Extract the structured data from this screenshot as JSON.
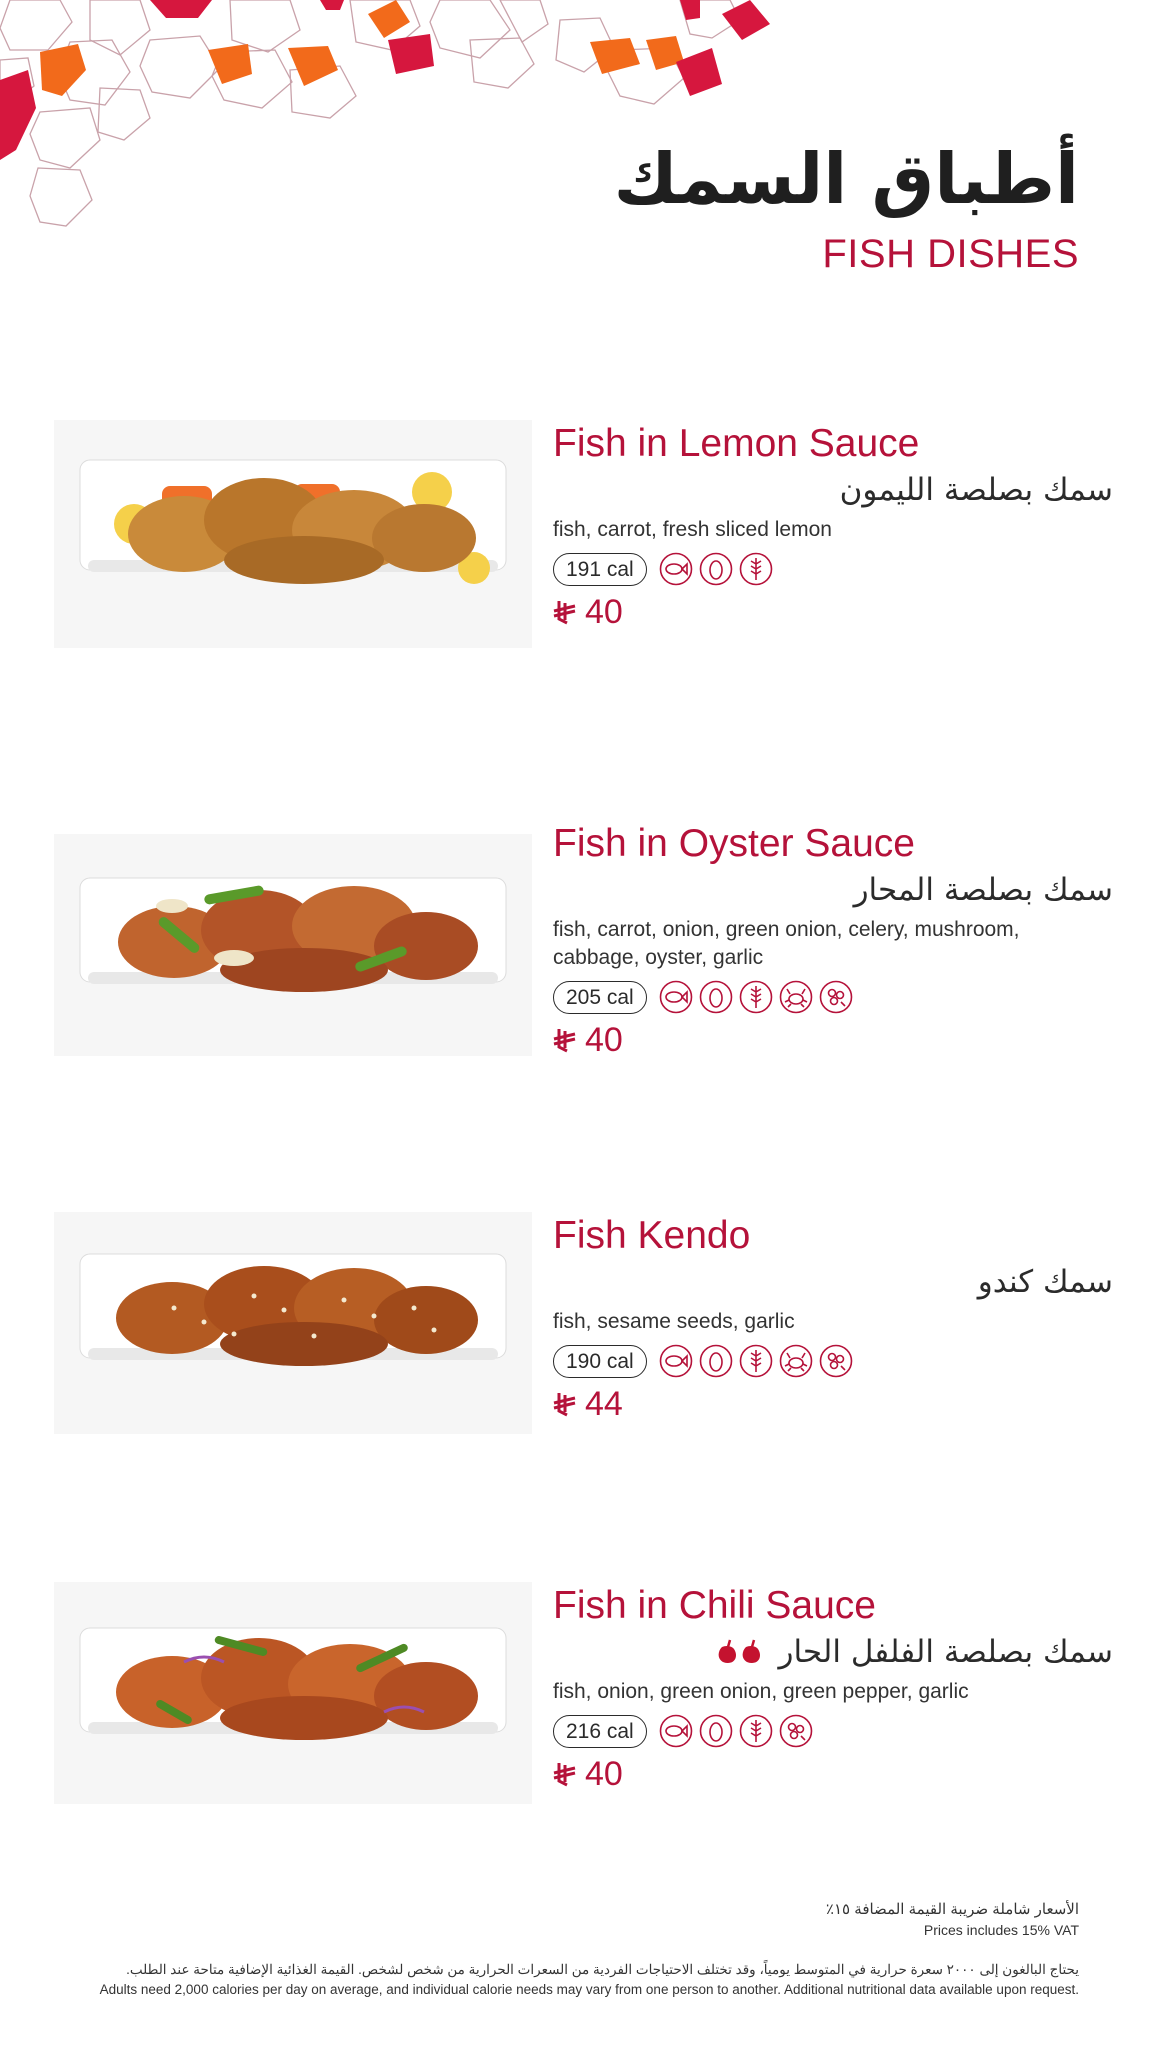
{
  "header": {
    "title_ar": "أطباق السمك",
    "title_en": "FISH DISHES"
  },
  "colors": {
    "accent": "#b5123a",
    "orange": "#f26a1b",
    "red": "#d6173e",
    "text": "#2b2b2b"
  },
  "currency_icon": "riyal-symbol-icon",
  "items": [
    {
      "name_en": "Fish in Lemon Sauce",
      "name_ar": "سمك بصلصة الليمون",
      "ingredients": "fish, carrot, fresh sliced lemon",
      "calories": "191 cal",
      "allergens": [
        "fish-icon",
        "egg-icon",
        "wheat-icon"
      ],
      "price": "40",
      "spicy": false
    },
    {
      "name_en": "Fish in Oyster Sauce",
      "name_ar": "سمك بصلصة المحار",
      "ingredients": "fish, carrot, onion, green onion, celery, mushroom, cabbage, oyster, garlic",
      "calories": "205 cal",
      "allergens": [
        "fish-icon",
        "egg-icon",
        "wheat-icon",
        "shellfish-icon",
        "soy-icon"
      ],
      "price": "40",
      "spicy": false
    },
    {
      "name_en": "Fish Kendo",
      "name_ar": "سمك كندو",
      "ingredients": "fish, sesame seeds, garlic",
      "calories": "190 cal",
      "allergens": [
        "fish-icon",
        "egg-icon",
        "wheat-icon",
        "shellfish-icon",
        "soy-icon"
      ],
      "price": "44",
      "spicy": false
    },
    {
      "name_en": "Fish in Chili Sauce",
      "name_ar": "سمك بصلصة الفلفل الحار",
      "ingredients": "fish, onion, green onion, green pepper, garlic",
      "calories": "216 cal",
      "allergens": [
        "fish-icon",
        "egg-icon",
        "wheat-icon",
        "soy-icon"
      ],
      "price": "40",
      "spicy": true
    }
  ],
  "footer": {
    "vat_ar": "الأسعار شاملة ضريبة القيمة المضافة ١٥٪",
    "vat_en": "Prices includes 15% VAT",
    "note_ar": "يحتاج البالغون إلى ٢٠٠٠ سعرة حرارية في المتوسط يومياً، وقد تختلف الاحتياجات الفردية من السعرات الحرارية من شخص لشخص. القيمة الغذائية الإضافية متاحة عند الطلب.",
    "note_en": "Adults need 2,000 calories per day on average, and individual calorie needs may vary from one person to another. Additional nutritional data available upon request."
  }
}
